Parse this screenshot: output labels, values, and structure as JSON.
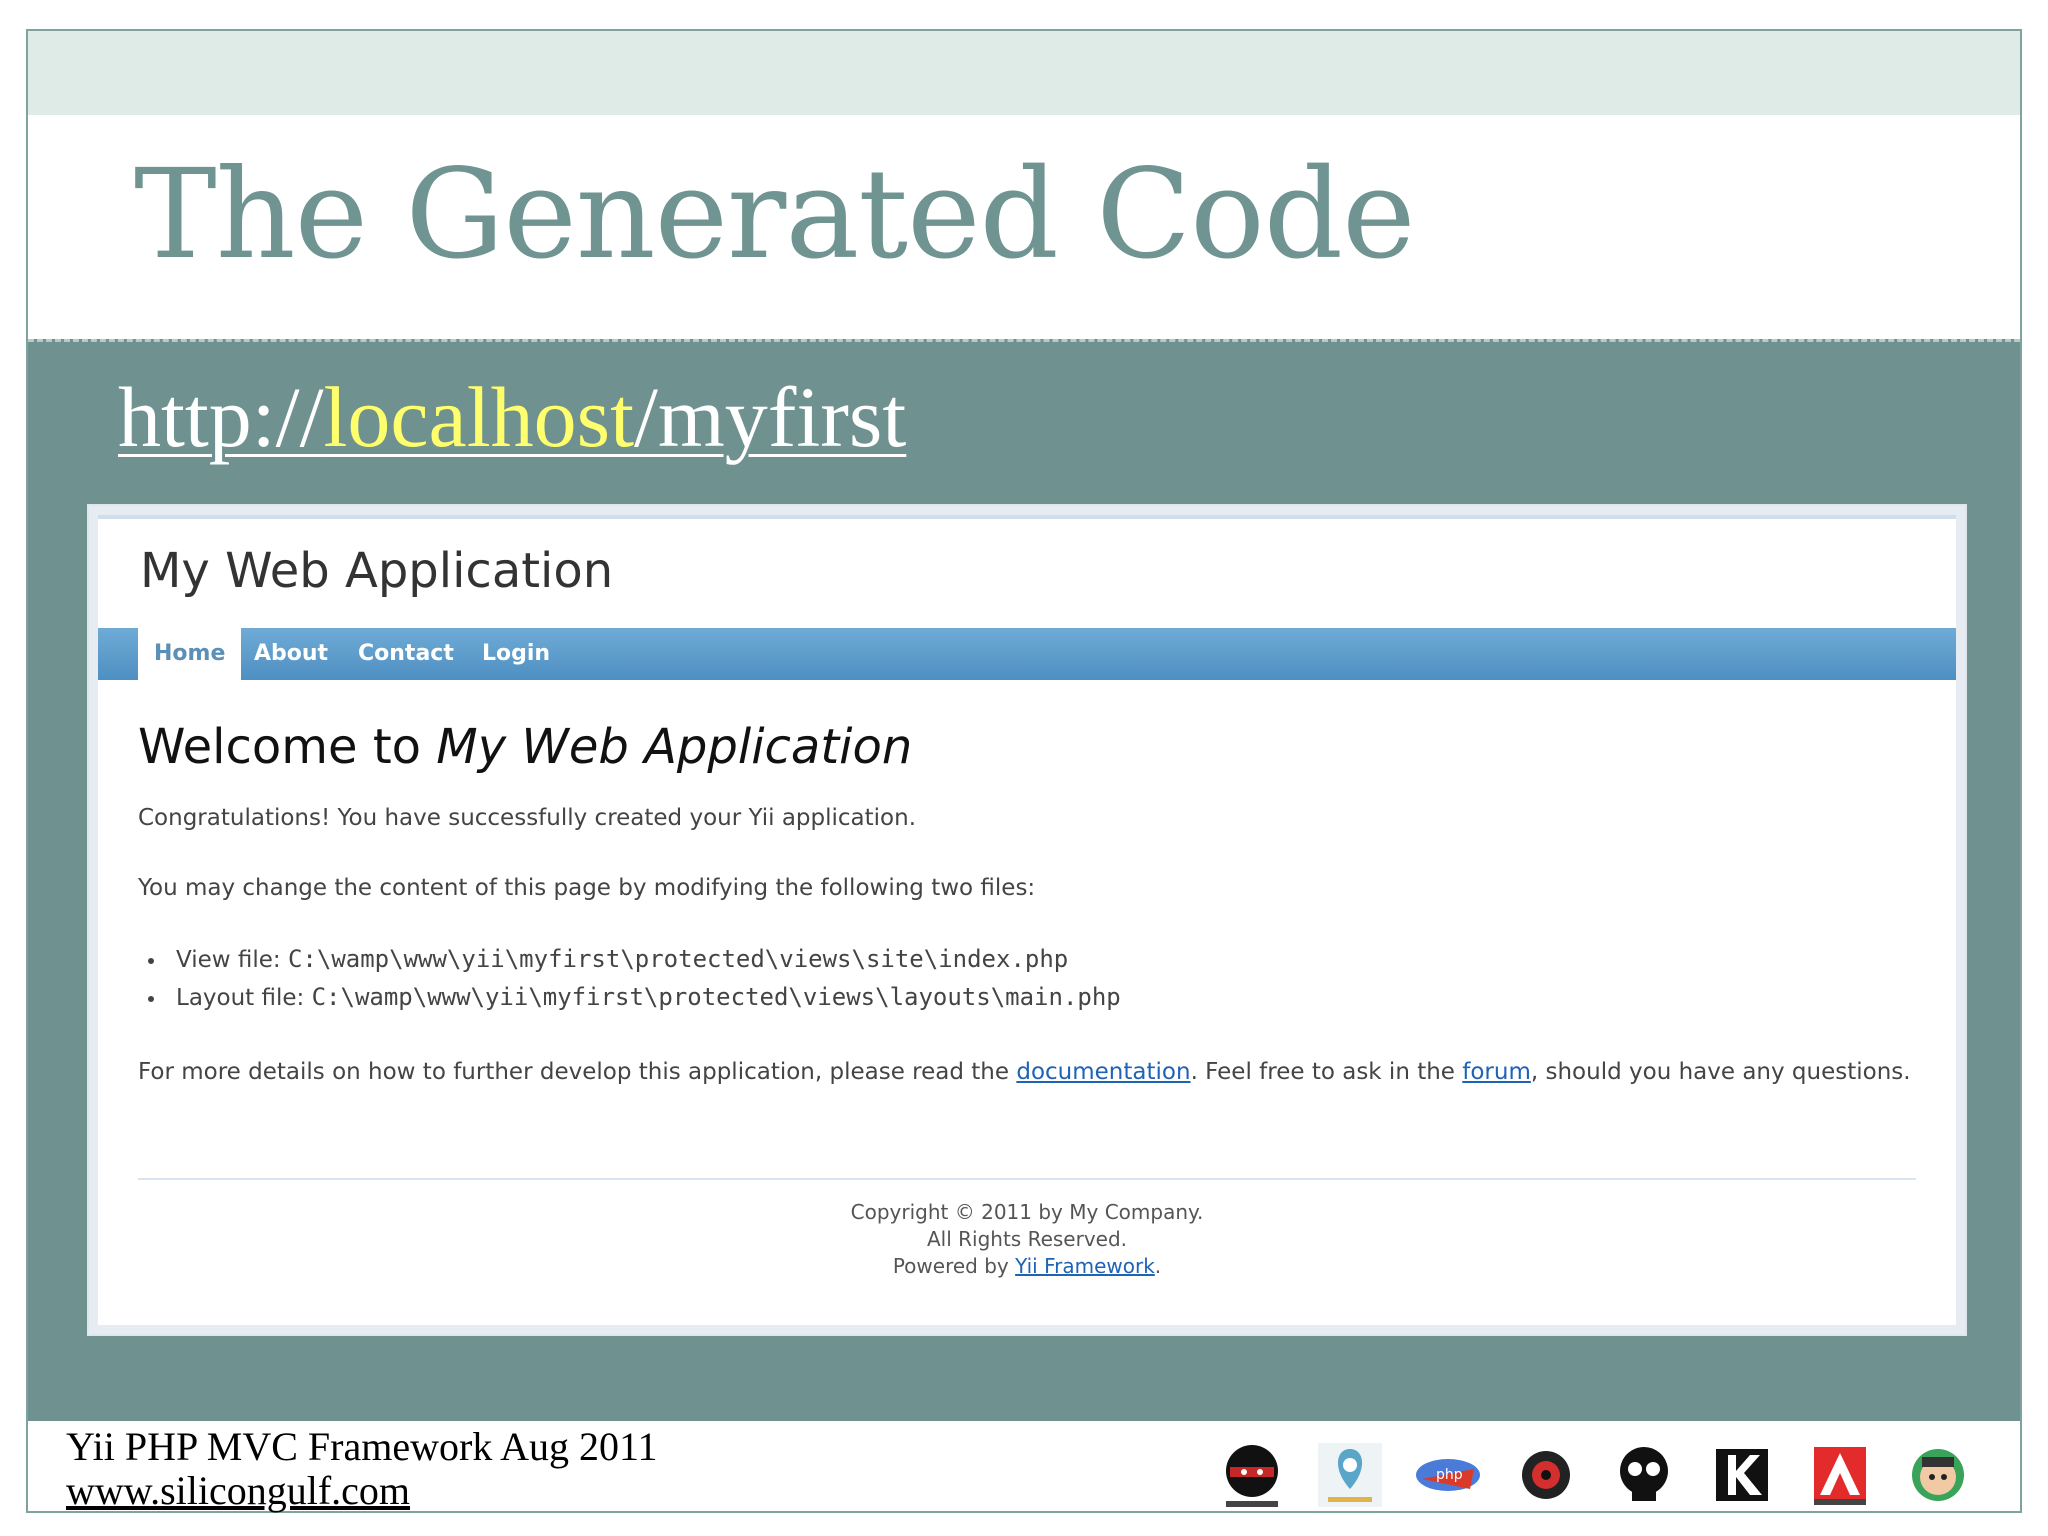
{
  "slide": {
    "title": "The Generated Code",
    "url_prefix": "http://",
    "url_host": "localhost",
    "url_path": "/myfirst",
    "footer_title": "Yii PHP MVC Framework Aug 2011",
    "footer_site": "www.silicongulf.com"
  },
  "app": {
    "title": "My Web Application",
    "nav": [
      "Home",
      "About",
      "Contact",
      "Login"
    ],
    "welcome_prefix": "Welcome to",
    "welcome_name": "My Web Application",
    "congrats": "Congratulations! You have successfully created your Yii application.",
    "change_intro": "You may change the content of this page by modifying the following two files:",
    "view_label": "View file:",
    "view_path": "C:\\wamp\\www\\yii\\myfirst\\protected\\views\\site\\index.php",
    "layout_label": "Layout file:",
    "layout_path": "C:\\wamp\\www\\yii\\myfirst\\protected\\views\\layouts\\main.php",
    "more_prefix": "For more details on how to further develop this application, please read the",
    "doc_link": "documentation",
    "more_mid": ". Feel free to ask in the",
    "forum_link": "forum",
    "more_suffix": ", should you have any questions.",
    "copyright": "Copyright © 2011 by My Company.",
    "rights": "All Rights Reserved.",
    "powered_prefix": "Powered by",
    "powered_link": "Yii Framework",
    "powered_suffix": "."
  },
  "colors": {
    "slide_teal": "#6f9290",
    "title_color": "#6f9491",
    "url_host_color": "#ffff6e",
    "nav_blue": "#4e8fc2",
    "link_blue": "#1f63b5"
  },
  "logos": [
    "ninja-icon",
    "location-pin-icon",
    "php-icon",
    "red-eye-icon",
    "skull-icon",
    "k-icon",
    "adobe-icon",
    "face-icon"
  ]
}
